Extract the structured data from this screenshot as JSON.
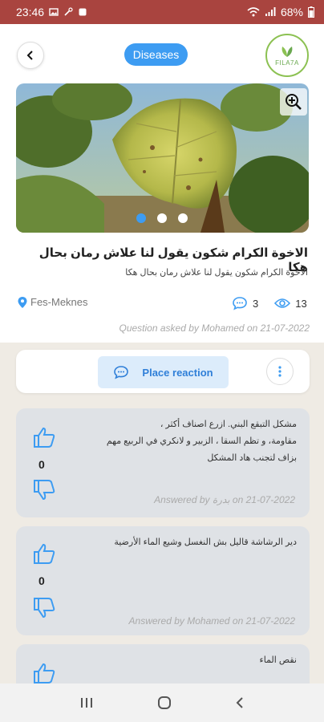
{
  "status_bar": {
    "time": "23:46",
    "battery": "68%"
  },
  "header": {
    "category": "Diseases",
    "logo_text": "FILA7A"
  },
  "question": {
    "title": "الاخوة الكرام شكون يقول لنا علاش رمان بحال هكا",
    "description": "الاخوة الكرام  شكون يقول لنا علاش رمان بحال هكا",
    "location": "Fes-Meknes",
    "comments_count": "3",
    "views_count": "13",
    "asked_by": "Question asked by Mohamed on 21-07-2022",
    "image_pages": 3,
    "image_active_page": 1
  },
  "reaction": {
    "place_reaction_label": "Place reaction"
  },
  "answers": [
    {
      "votes": "0",
      "lines": [
        "مشكل التبقع البني. ازرع اصناف أكثر ،",
        "مقاومة، و تظم السقا ، الزبير و لانكري في الربيع مهم",
        "بزاف لتجنب هاد المشكل"
      ],
      "answered_by": "Answered by بدرة on 21-07-2022"
    },
    {
      "votes": "0",
      "lines": [
        "دير الرشاشة قاليل بش النغسل وشيع الماء الأرضية"
      ],
      "answered_by": "Answered by Mohamed on 21-07-2022"
    },
    {
      "votes": "",
      "lines": [
        "نقص الماء"
      ],
      "answered_by": ""
    }
  ],
  "colors": {
    "accent": "#3d9cf2",
    "status_bar": "#a9443f",
    "answer_bg": "#dfe2e6"
  }
}
